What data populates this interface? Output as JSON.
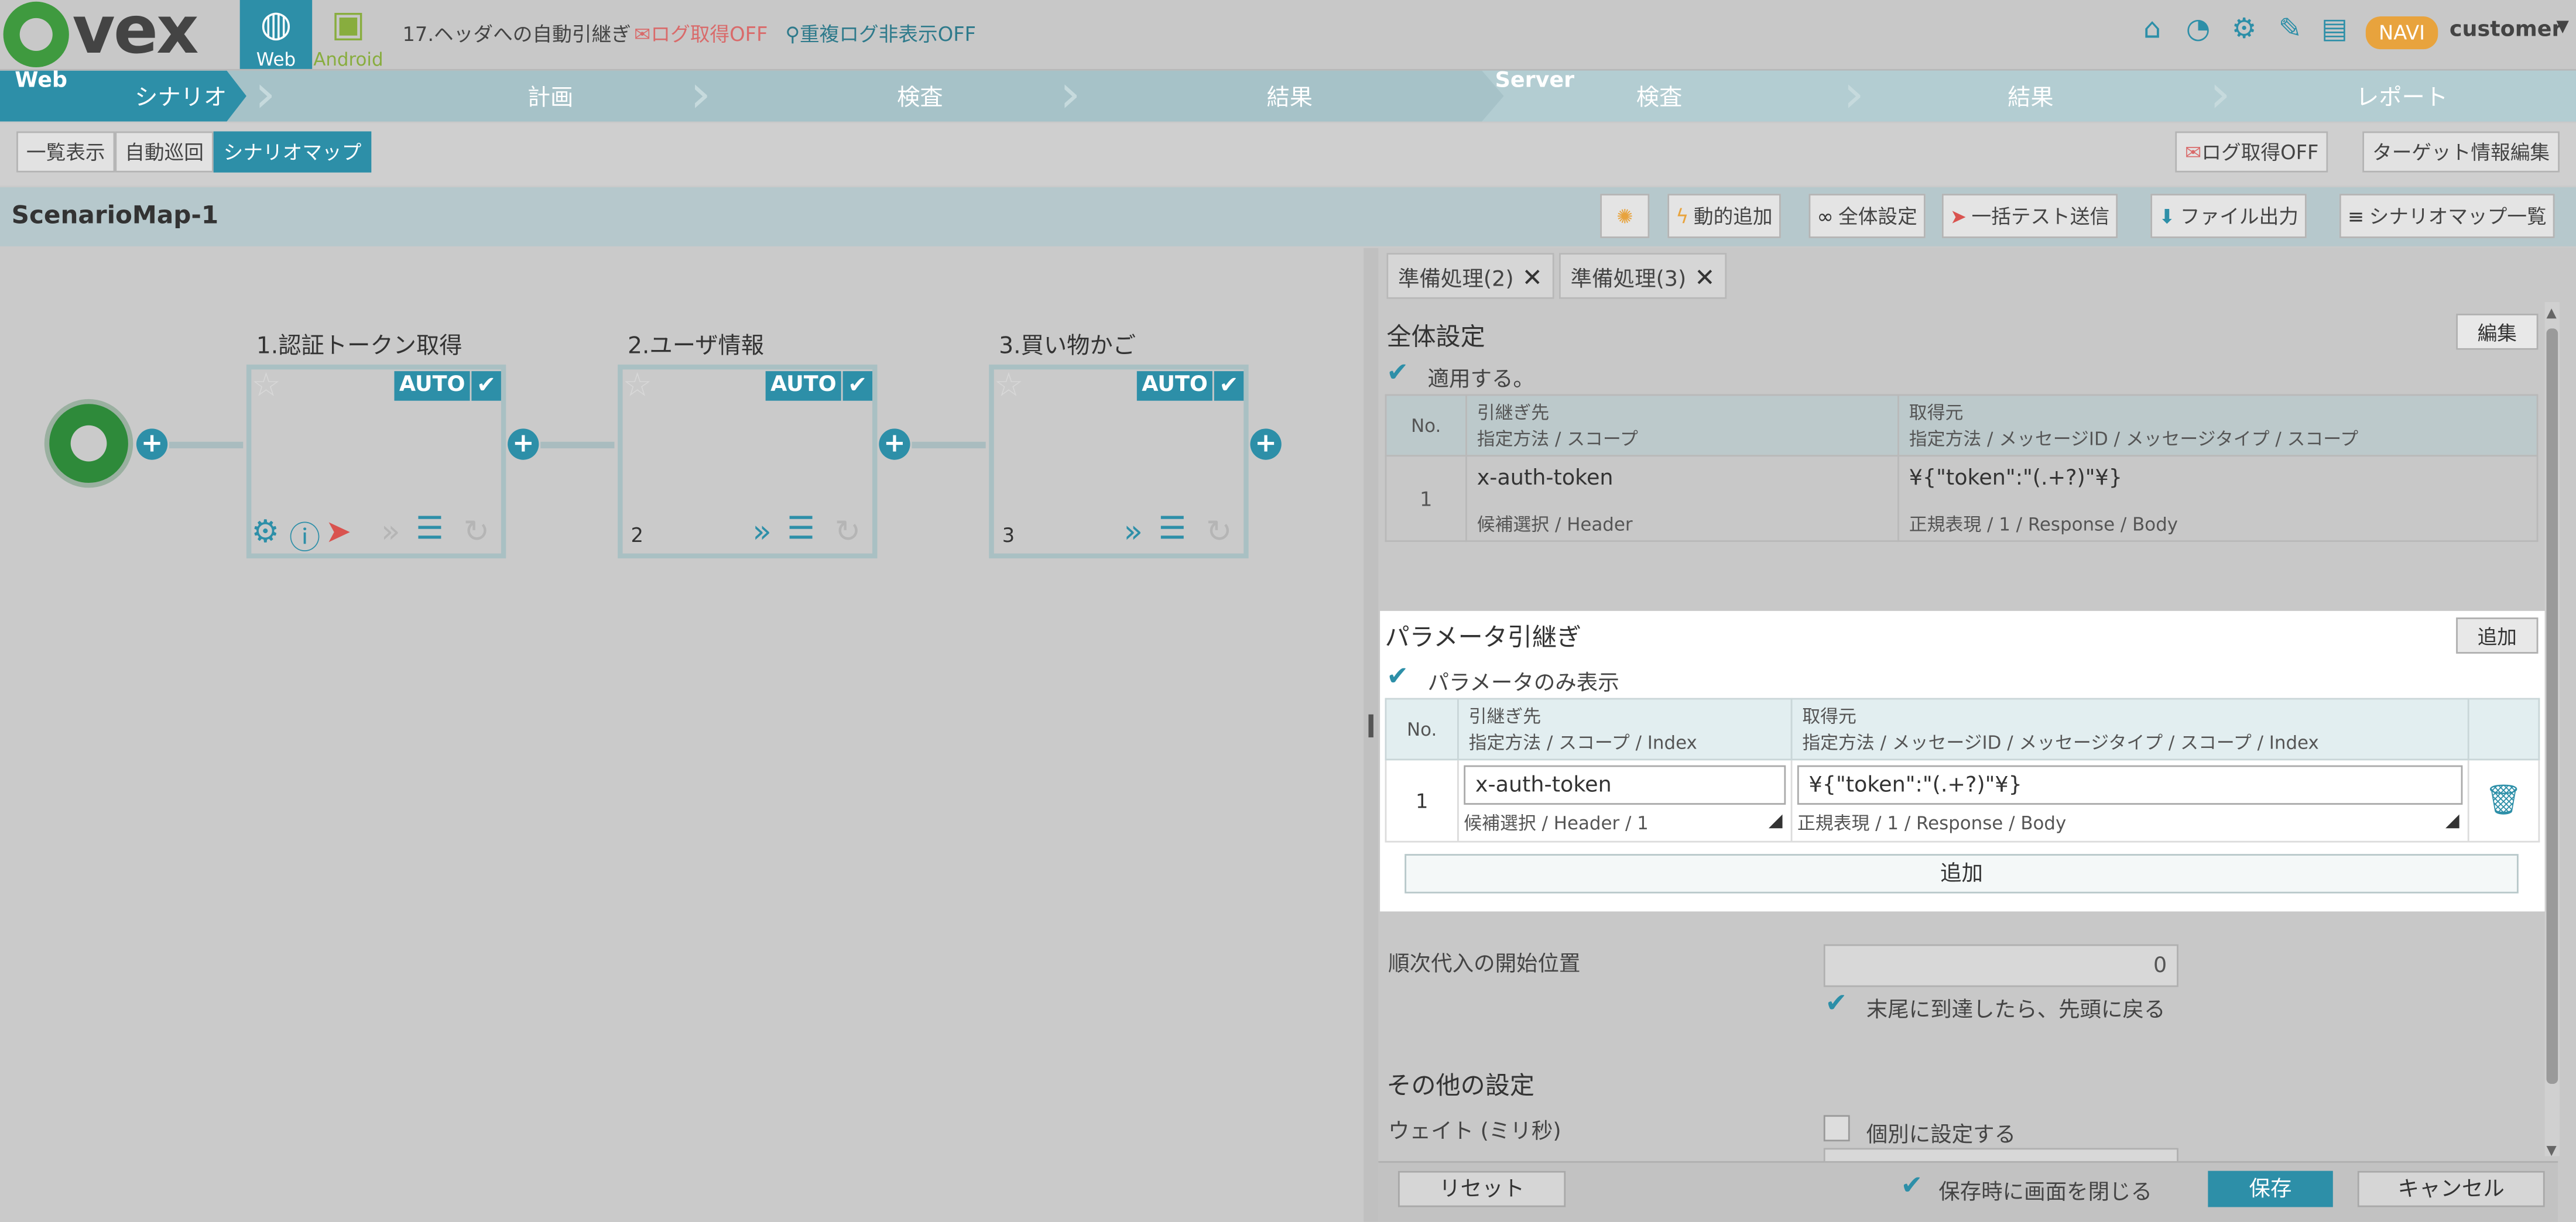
{
  "app": {
    "logo_text": "vex",
    "platforms": [
      {
        "label": "Web",
        "active": true
      },
      {
        "label": "Android",
        "active": false
      }
    ],
    "scenario_title": "17.ヘッダへの自動引継ぎ",
    "log_flag": "ログ取得OFF",
    "dup_log_flag": "重複ログ非表示OFF",
    "navi_badge": "NAVI",
    "user": "customer",
    "colors": {
      "accent": "#2d8fa8",
      "alert": "#d96a6a",
      "badge": "#e8a33d"
    },
    "top_icons": [
      "home-icon",
      "dashboard-icon",
      "gear-icon",
      "wrench-icon",
      "book-icon"
    ]
  },
  "steps": {
    "web_tag": "Web",
    "server_tag": "Server",
    "web": [
      "シナリオ",
      "計画",
      "検査",
      "結果"
    ],
    "server": [
      "検査",
      "結果",
      "レポート"
    ]
  },
  "toolbar": {
    "views": [
      "一覧表示",
      "自動巡回",
      "シナリオマップ"
    ],
    "active_view": "シナリオマップ",
    "log_button": "ログ取得OFF",
    "target_button": "ターゲット情報編集"
  },
  "map_header": {
    "name": "ScenarioMap-1",
    "buttons": [
      "動的追加",
      "全体設定",
      "一括テスト送信",
      "ファイル出力",
      "シナリオマップ一覧"
    ]
  },
  "nodes": [
    {
      "title": "1.認証トークン取得",
      "badge": "AUTO",
      "number": ""
    },
    {
      "title": "2.ユーザ情報",
      "badge": "AUTO",
      "number": "2"
    },
    {
      "title": "3.買い物かご",
      "badge": "AUTO",
      "number": "3"
    }
  ],
  "panel": {
    "tabs": [
      {
        "label": "準備処理(2)"
      },
      {
        "label": "準備処理(3)"
      }
    ],
    "global": {
      "title": "全体設定",
      "edit_button": "編集",
      "apply_label": "適用する。",
      "col_no": "No.",
      "col_dest_line1": "引継ぎ先",
      "col_dest_line2": "指定方法 / スコープ",
      "col_src_line1": "取得元",
      "col_src_line2": "指定方法 / メッセージID / メッセージタイプ / スコープ",
      "rows": [
        {
          "no": "1",
          "dest": "x-auth-token",
          "dest_meta": "候補選択 / Header",
          "src": "¥{\"token\":\"(.+?)\"¥}",
          "src_meta": "正規表現 / 1 / Response / Body"
        }
      ]
    },
    "param": {
      "title": "パラメータ引継ぎ",
      "add_button": "追加",
      "params_only_label": "パラメータのみ表示",
      "col_no": "No.",
      "col_dest_line1": "引継ぎ先",
      "col_dest_line2": "指定方法 / スコープ / Index",
      "col_src_line1": "取得元",
      "col_src_line2": "指定方法 / メッセージID / メッセージタイプ / スコープ / Index",
      "rows": [
        {
          "no": "1",
          "dest": "x-auth-token",
          "dest_meta": "候補選択 / Header / 1",
          "src": "¥{\"token\":\"(.+?)\"¥}",
          "src_meta": "正規表現 / 1 / Response / Body"
        }
      ],
      "add_row_button": "追加"
    },
    "sequential": {
      "label": "順次代入の開始位置",
      "value": "0",
      "wrap_label": "末尾に到達したら、先頭に戻る"
    },
    "other": {
      "title": "その他の設定",
      "wait_label": "ウェイト (ミリ秒)",
      "individual_label": "個別に設定する"
    },
    "footer": {
      "reset": "リセット",
      "close_on_save": "保存時に画面を閉じる",
      "save": "保存",
      "cancel": "キャンセル"
    }
  }
}
